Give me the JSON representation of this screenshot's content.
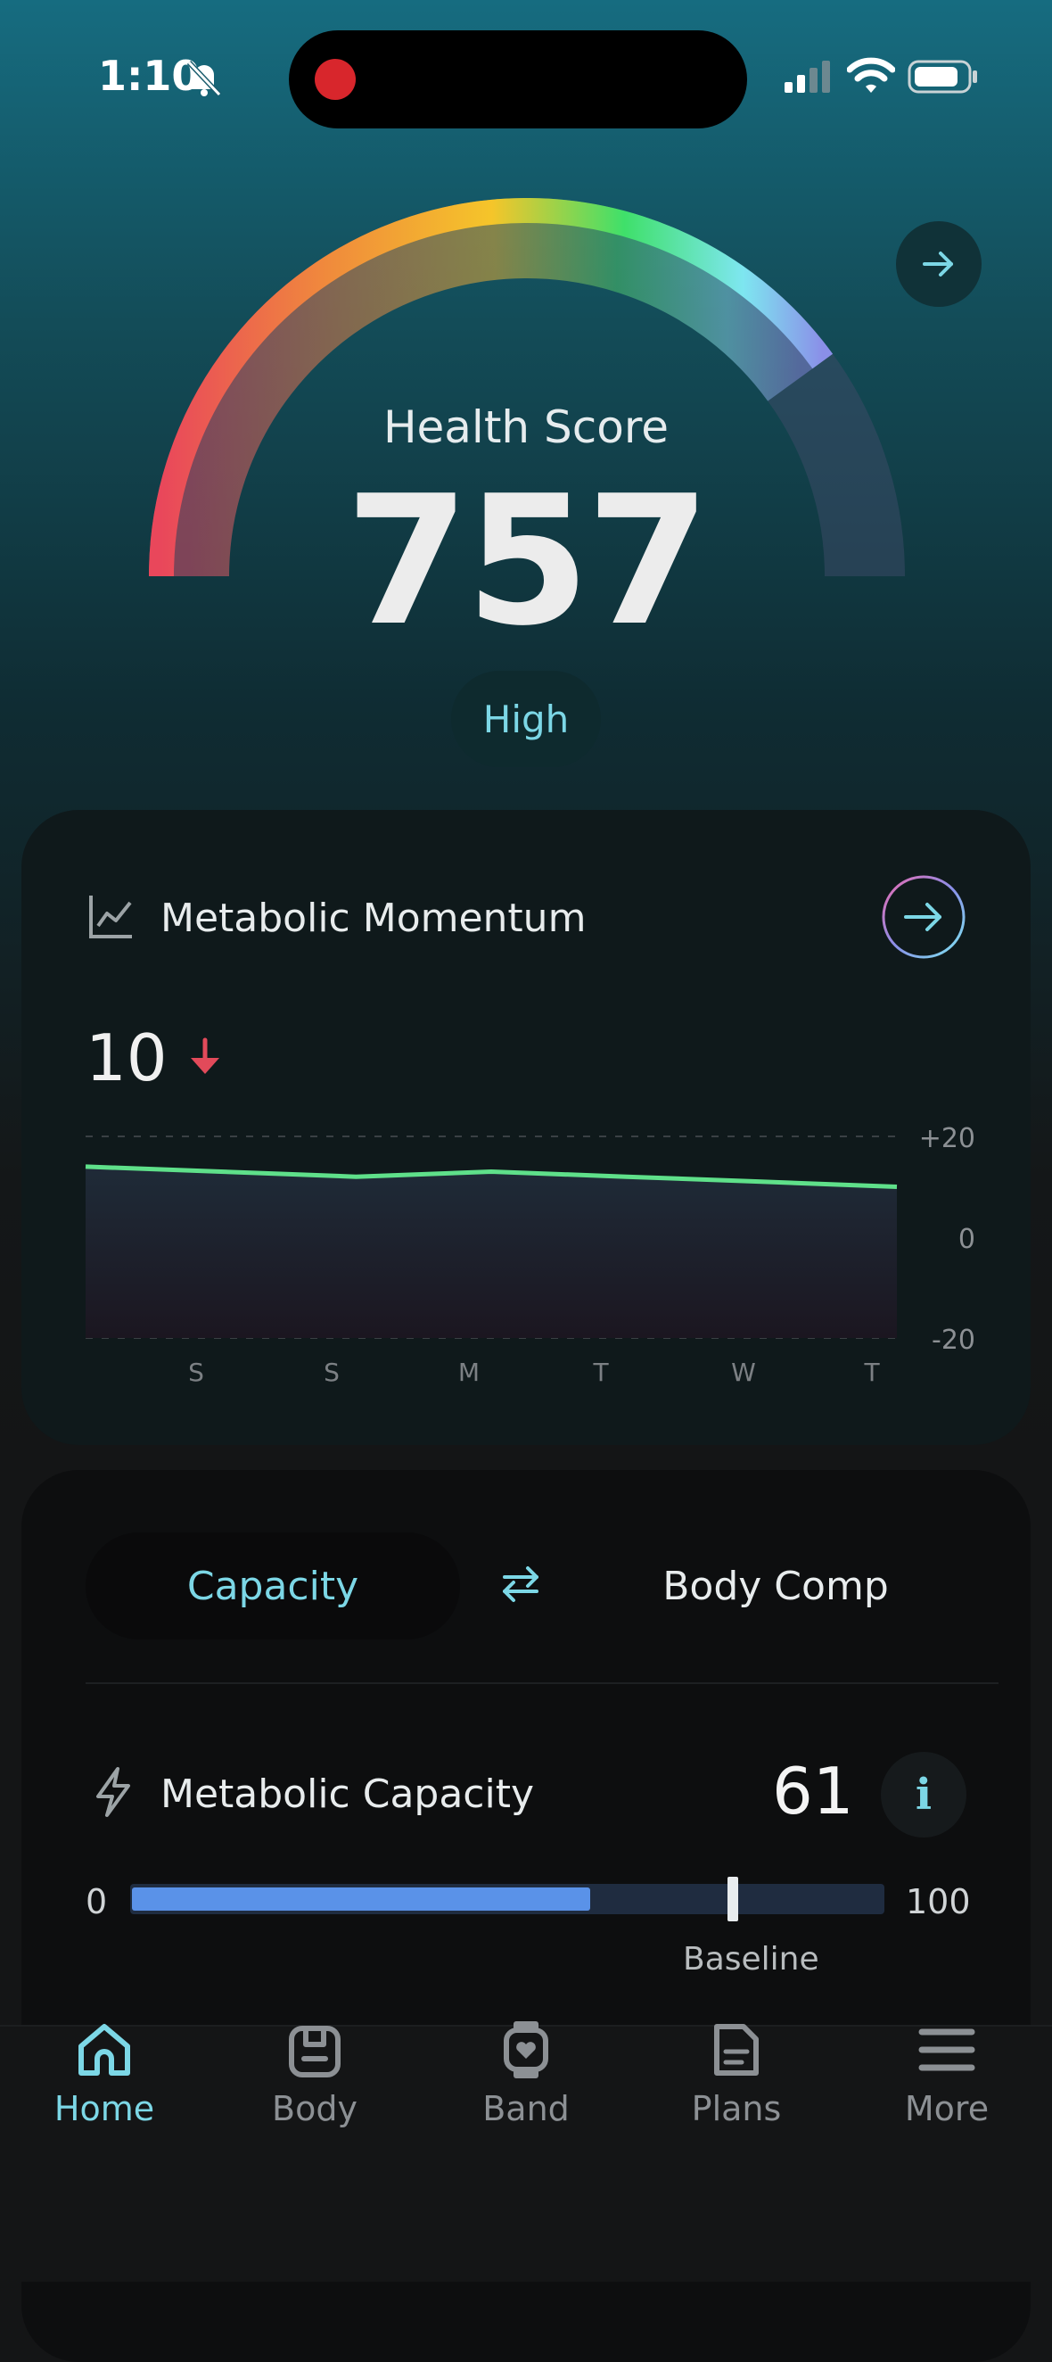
{
  "status_bar": {
    "time": "1:10",
    "icons": [
      "bell-slash-icon",
      "record-icon",
      "signal-icon",
      "wifi-icon",
      "battery-icon"
    ]
  },
  "health_score": {
    "label": "Health Score",
    "value": "757",
    "badge": "High",
    "gauge_colors": [
      "#e9475b",
      "#f08a3c",
      "#f5c52a",
      "#3fe06a",
      "#7ee6f0",
      "#8a8fe8"
    ]
  },
  "metabolic_momentum": {
    "title": "Metabolic Momentum",
    "value": "10",
    "trend": "down",
    "chart_data": {
      "type": "line",
      "categories": [
        "S",
        "S",
        "M",
        "T",
        "W",
        "T"
      ],
      "y_ticks": [
        "+20",
        "0",
        "-20"
      ],
      "ylim": [
        -20,
        20
      ],
      "series": [
        {
          "values": [
            14,
            13,
            12,
            13,
            12,
            11,
            10
          ]
        }
      ],
      "line_color": "#5fe08a",
      "grid": "dashed"
    }
  },
  "segments": {
    "left": "Capacity",
    "right": "Body Comp",
    "active": "left"
  },
  "metabolic_capacity": {
    "title": "Metabolic Capacity",
    "value": "61",
    "info": "i",
    "range_min": "0",
    "range_max": "100",
    "fill_value": 61,
    "baseline_value": 80,
    "baseline_label": "Baseline"
  },
  "tabbar": {
    "items": [
      {
        "label": "Home",
        "icon": "home-icon",
        "active": true
      },
      {
        "label": "Body",
        "icon": "clipboard-icon",
        "active": false
      },
      {
        "label": "Band",
        "icon": "watch-heart-icon",
        "active": false
      },
      {
        "label": "Plans",
        "icon": "document-icon",
        "active": false
      },
      {
        "label": "More",
        "icon": "menu-icon",
        "active": false
      }
    ]
  },
  "colors": {
    "accent": "#7cd7e6",
    "down_red": "#e24a5a",
    "bar_fill": "#5a92e8"
  }
}
